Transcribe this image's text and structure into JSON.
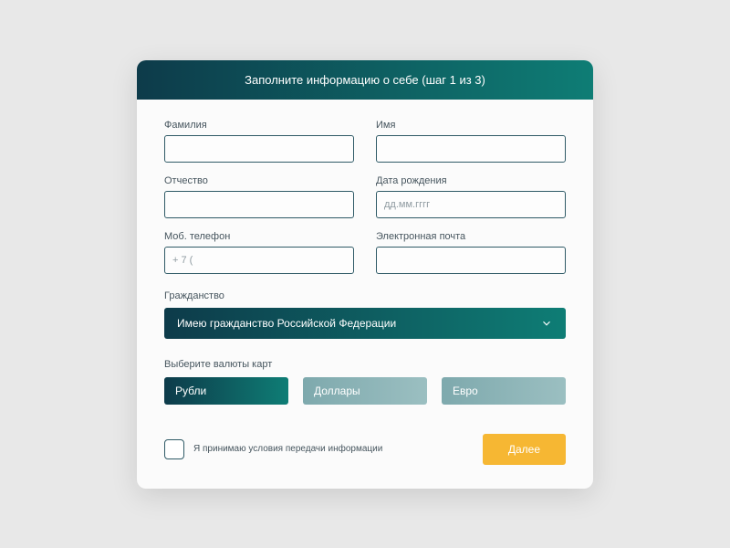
{
  "header": {
    "title": "Заполните информацию о себе (шаг 1 из 3)"
  },
  "fields": {
    "lastname": {
      "label": "Фамилия",
      "value": ""
    },
    "firstname": {
      "label": "Имя",
      "value": ""
    },
    "patronymic": {
      "label": "Отчество",
      "value": ""
    },
    "dob": {
      "label": "Дата рождения",
      "placeholder": "дд.мм.гггг",
      "value": ""
    },
    "phone": {
      "label": "Моб. телефон",
      "placeholder": "+ 7 (",
      "value": ""
    },
    "email": {
      "label": "Электронная почта",
      "value": ""
    }
  },
  "citizenship": {
    "label": "Гражданство",
    "selected": "Имею гражданство Российской Федерации"
  },
  "currency": {
    "label": "Выберите валюты карт",
    "options": [
      {
        "label": "Рубли",
        "active": true
      },
      {
        "label": "Доллары",
        "active": false
      },
      {
        "label": "Евро",
        "active": false
      }
    ]
  },
  "consent": {
    "label": "Я принимаю условия передачи информации",
    "checked": false
  },
  "buttons": {
    "next": "Далее"
  }
}
